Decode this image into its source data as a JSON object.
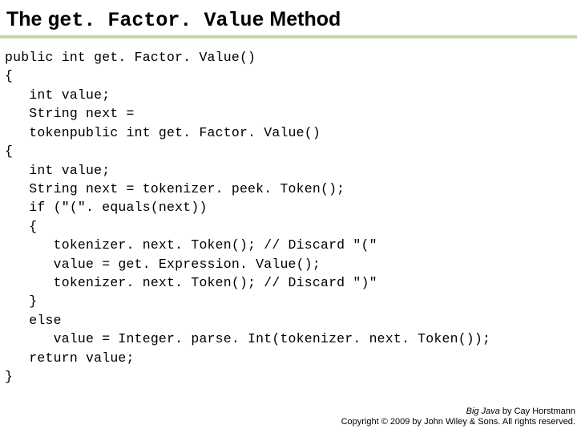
{
  "title": {
    "pre": "The ",
    "mono": "get. Factor. Value",
    "post": " Method"
  },
  "code": "public int get. Factor. Value()\n{\n   int value;\n   String next =\n   tokenpublic int get. Factor. Value()\n{\n   int value;\n   String next = tokenizer. peek. Token();\n   if (\"(\". equals(next))\n   {\n      tokenizer. next. Token(); // Discard \"(\"\n      value = get. Expression. Value();\n      tokenizer. next. Token(); // Discard \")\"\n   }\n   else\n      value = Integer. parse. Int(tokenizer. next. Token());\n   return value;\n}",
  "footer": {
    "book": "Big Java",
    "byline": " by Cay Horstmann",
    "copyright": "Copyright © 2009 by John Wiley & Sons. All rights reserved."
  }
}
